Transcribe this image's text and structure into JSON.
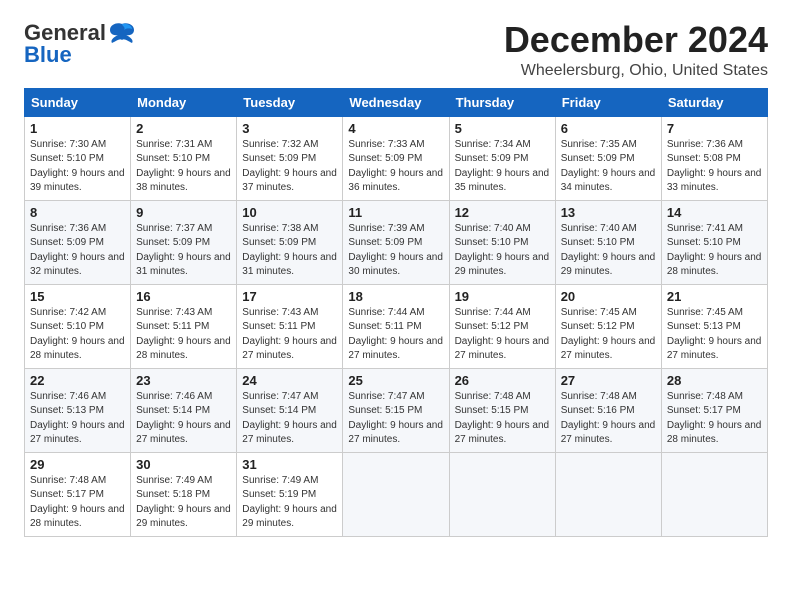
{
  "logo": {
    "general": "General",
    "blue": "Blue"
  },
  "title": "December 2024",
  "subtitle": "Wheelersburg, Ohio, United States",
  "days_of_week": [
    "Sunday",
    "Monday",
    "Tuesday",
    "Wednesday",
    "Thursday",
    "Friday",
    "Saturday"
  ],
  "weeks": [
    [
      {
        "day": "1",
        "sunrise": "7:30 AM",
        "sunset": "5:10 PM",
        "daylight": "9 hours and 39 minutes."
      },
      {
        "day": "2",
        "sunrise": "7:31 AM",
        "sunset": "5:10 PM",
        "daylight": "9 hours and 38 minutes."
      },
      {
        "day": "3",
        "sunrise": "7:32 AM",
        "sunset": "5:09 PM",
        "daylight": "9 hours and 37 minutes."
      },
      {
        "day": "4",
        "sunrise": "7:33 AM",
        "sunset": "5:09 PM",
        "daylight": "9 hours and 36 minutes."
      },
      {
        "day": "5",
        "sunrise": "7:34 AM",
        "sunset": "5:09 PM",
        "daylight": "9 hours and 35 minutes."
      },
      {
        "day": "6",
        "sunrise": "7:35 AM",
        "sunset": "5:09 PM",
        "daylight": "9 hours and 34 minutes."
      },
      {
        "day": "7",
        "sunrise": "7:36 AM",
        "sunset": "5:08 PM",
        "daylight": "9 hours and 33 minutes."
      }
    ],
    [
      {
        "day": "8",
        "sunrise": "7:36 AM",
        "sunset": "5:09 PM",
        "daylight": "9 hours and 32 minutes."
      },
      {
        "day": "9",
        "sunrise": "7:37 AM",
        "sunset": "5:09 PM",
        "daylight": "9 hours and 31 minutes."
      },
      {
        "day": "10",
        "sunrise": "7:38 AM",
        "sunset": "5:09 PM",
        "daylight": "9 hours and 31 minutes."
      },
      {
        "day": "11",
        "sunrise": "7:39 AM",
        "sunset": "5:09 PM",
        "daylight": "9 hours and 30 minutes."
      },
      {
        "day": "12",
        "sunrise": "7:40 AM",
        "sunset": "5:10 PM",
        "daylight": "9 hours and 29 minutes."
      },
      {
        "day": "13",
        "sunrise": "7:40 AM",
        "sunset": "5:10 PM",
        "daylight": "9 hours and 29 minutes."
      },
      {
        "day": "14",
        "sunrise": "7:41 AM",
        "sunset": "5:10 PM",
        "daylight": "9 hours and 28 minutes."
      }
    ],
    [
      {
        "day": "15",
        "sunrise": "7:42 AM",
        "sunset": "5:10 PM",
        "daylight": "9 hours and 28 minutes."
      },
      {
        "day": "16",
        "sunrise": "7:43 AM",
        "sunset": "5:11 PM",
        "daylight": "9 hours and 28 minutes."
      },
      {
        "day": "17",
        "sunrise": "7:43 AM",
        "sunset": "5:11 PM",
        "daylight": "9 hours and 27 minutes."
      },
      {
        "day": "18",
        "sunrise": "7:44 AM",
        "sunset": "5:11 PM",
        "daylight": "9 hours and 27 minutes."
      },
      {
        "day": "19",
        "sunrise": "7:44 AM",
        "sunset": "5:12 PM",
        "daylight": "9 hours and 27 minutes."
      },
      {
        "day": "20",
        "sunrise": "7:45 AM",
        "sunset": "5:12 PM",
        "daylight": "9 hours and 27 minutes."
      },
      {
        "day": "21",
        "sunrise": "7:45 AM",
        "sunset": "5:13 PM",
        "daylight": "9 hours and 27 minutes."
      }
    ],
    [
      {
        "day": "22",
        "sunrise": "7:46 AM",
        "sunset": "5:13 PM",
        "daylight": "9 hours and 27 minutes."
      },
      {
        "day": "23",
        "sunrise": "7:46 AM",
        "sunset": "5:14 PM",
        "daylight": "9 hours and 27 minutes."
      },
      {
        "day": "24",
        "sunrise": "7:47 AM",
        "sunset": "5:14 PM",
        "daylight": "9 hours and 27 minutes."
      },
      {
        "day": "25",
        "sunrise": "7:47 AM",
        "sunset": "5:15 PM",
        "daylight": "9 hours and 27 minutes."
      },
      {
        "day": "26",
        "sunrise": "7:48 AM",
        "sunset": "5:15 PM",
        "daylight": "9 hours and 27 minutes."
      },
      {
        "day": "27",
        "sunrise": "7:48 AM",
        "sunset": "5:16 PM",
        "daylight": "9 hours and 27 minutes."
      },
      {
        "day": "28",
        "sunrise": "7:48 AM",
        "sunset": "5:17 PM",
        "daylight": "9 hours and 28 minutes."
      }
    ],
    [
      {
        "day": "29",
        "sunrise": "7:48 AM",
        "sunset": "5:17 PM",
        "daylight": "9 hours and 28 minutes."
      },
      {
        "day": "30",
        "sunrise": "7:49 AM",
        "sunset": "5:18 PM",
        "daylight": "9 hours and 29 minutes."
      },
      {
        "day": "31",
        "sunrise": "7:49 AM",
        "sunset": "5:19 PM",
        "daylight": "9 hours and 29 minutes."
      },
      null,
      null,
      null,
      null
    ]
  ]
}
